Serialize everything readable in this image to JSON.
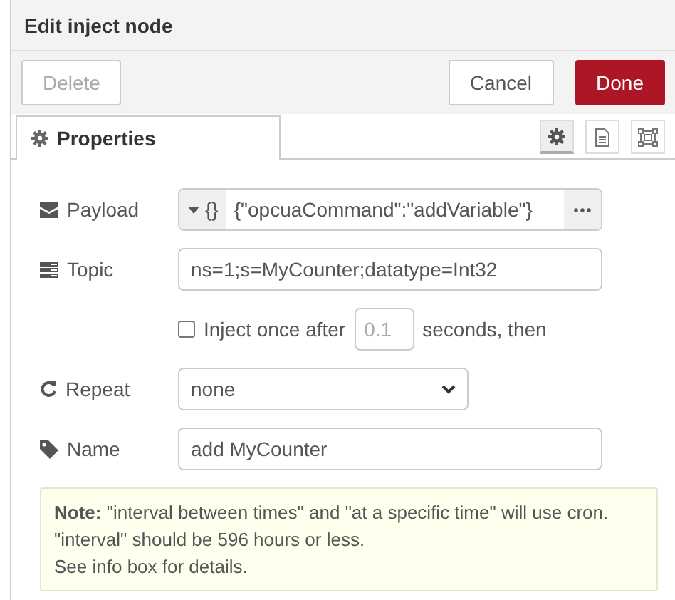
{
  "window": {
    "title": "Edit inject node"
  },
  "buttons": [
    {
      "label": "Delete",
      "kind": "secondary",
      "disabled": true
    },
    {
      "label": "Cancel",
      "kind": "secondary",
      "disabled": false
    },
    {
      "label": "Done",
      "kind": "primary",
      "disabled": false
    }
  ],
  "tabs": [
    {
      "label": "Properties",
      "selected": true
    }
  ],
  "tab_buttons": [
    {
      "selected": true
    },
    {
      "selected": false
    },
    {
      "selected": false
    }
  ],
  "form": [
    {
      "kind": "typed",
      "label": "Payload",
      "type": "{}",
      "value": "{\"opcuaCommand\":\"addVariable\"}"
    },
    {
      "kind": "input",
      "label": "Topic",
      "value": "ns=1;s=MyCounter;datatype=Int32"
    },
    {
      "kind": "once",
      "checked": false,
      "text": "Inject once after",
      "value": "0.1",
      "disabled": true,
      "after": "seconds, then"
    },
    {
      "kind": "select",
      "label": "Repeat",
      "value": "none"
    },
    {
      "kind": "input",
      "label": "Name",
      "value": "add MyCounter"
    }
  ],
  "note": [
    "**Note:** \"interval between times\" and \"at a specific time\" will use cron.",
    "\"interval\" should be 596 hours or less.",
    "See info box for details."
  ]
}
